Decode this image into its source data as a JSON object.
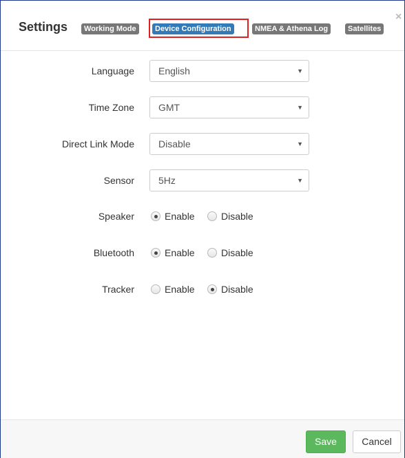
{
  "header": {
    "title": "Settings",
    "tabs": [
      {
        "label": "Working Mode",
        "active": false
      },
      {
        "label": "Device Configuration",
        "active": true
      },
      {
        "label": "NMEA & Athena Log",
        "active": false
      },
      {
        "label": "Satellites",
        "active": false
      }
    ],
    "close_symbol": "×"
  },
  "form": {
    "language": {
      "label": "Language",
      "value": "English"
    },
    "time_zone": {
      "label": "Time Zone",
      "value": "GMT"
    },
    "direct_link_mode": {
      "label": "Direct Link Mode",
      "value": "Disable"
    },
    "sensor": {
      "label": "Sensor",
      "value": "5Hz"
    },
    "speaker": {
      "label": "Speaker",
      "options": [
        "Enable",
        "Disable"
      ],
      "selected": "Enable"
    },
    "bluetooth": {
      "label": "Bluetooth",
      "options": [
        "Enable",
        "Disable"
      ],
      "selected": "Enable"
    },
    "tracker": {
      "label": "Tracker",
      "options": [
        "Enable",
        "Disable"
      ],
      "selected": "Disable"
    }
  },
  "footer": {
    "save_label": "Save",
    "cancel_label": "Cancel"
  },
  "colors": {
    "active_tab": "#337ab7",
    "inactive_tab": "#777777",
    "save_button": "#5cb85c",
    "highlight_box": "#e0201f"
  },
  "icons": {
    "dropdown": "caret-down-icon",
    "close": "close-icon"
  }
}
